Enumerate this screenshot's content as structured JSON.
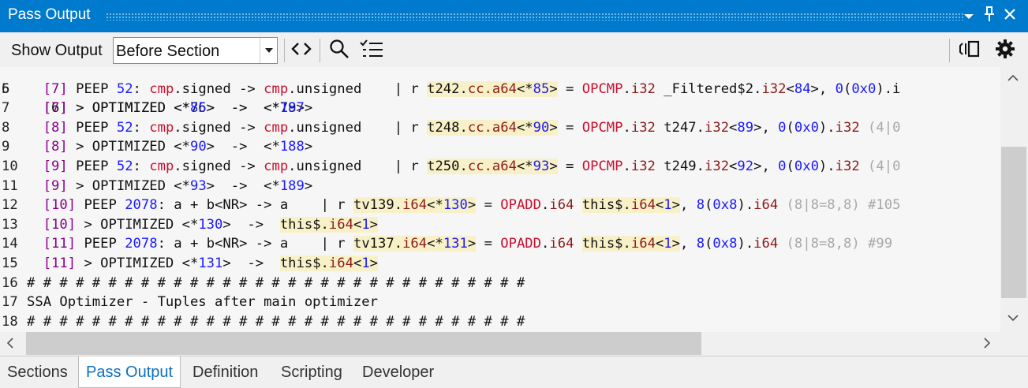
{
  "window": {
    "title": "Pass Output"
  },
  "toolbar": {
    "show_output_label": "Show Output",
    "section_select": {
      "value": "Before Section"
    }
  },
  "icons": {
    "dropdown": "chevron-down-icon",
    "pin": "pin-icon",
    "close": "close-icon",
    "combo": "chevron-down-icon",
    "code": "code-brackets-icon",
    "search": "search-icon",
    "filter": "checklist-icon",
    "sync": "sync-panel-icon",
    "settings": "gear-icon"
  },
  "editor": {
    "partial_top_line": {
      "num": "5",
      "text": "  [6] > OPTIMIZED <*76>  ->  <*79>"
    },
    "lines": [
      {
        "num": "6",
        "tokens": [
          {
            "t": "  "
          },
          {
            "t": "[7]",
            "c": "c-purple"
          },
          {
            "t": " PEEP "
          },
          {
            "t": "52",
            "c": "c-blue"
          },
          {
            "t": ": "
          },
          {
            "t": "cmp",
            "c": "c-red"
          },
          {
            "t": ".signed -> "
          },
          {
            "t": "cmp",
            "c": "c-red"
          },
          {
            "t": ".unsigned    | r "
          },
          {
            "t": "t242.",
            "h": 1
          },
          {
            "t": "cc.a64",
            "c": "c-dark",
            "h": 1
          },
          {
            "t": "<*",
            "h": 1
          },
          {
            "t": "85",
            "c": "c-blue",
            "h": 1
          },
          {
            "t": ">",
            "h": 1
          },
          {
            "t": " = "
          },
          {
            "t": "OPCMP",
            "c": "c-red"
          },
          {
            "t": "."
          },
          {
            "t": "i32",
            "c": "c-dark"
          },
          {
            "t": " _Filtered$2."
          },
          {
            "t": "i32",
            "c": "c-dark"
          },
          {
            "t": "<"
          },
          {
            "t": "84",
            "c": "c-blue"
          },
          {
            "t": ">, "
          },
          {
            "t": "0",
            "c": "c-blue"
          },
          {
            "t": "("
          },
          {
            "t": "0x0",
            "c": "c-blue"
          },
          {
            "t": ").i"
          }
        ]
      },
      {
        "num": "7",
        "tokens": [
          {
            "t": "  "
          },
          {
            "t": "[7]",
            "c": "c-purple"
          },
          {
            "t": " > OPTIMIZED <*"
          },
          {
            "t": "85",
            "c": "c-blue"
          },
          {
            "t": ">  ->  <*"
          },
          {
            "t": "187",
            "c": "c-blue"
          },
          {
            "t": ">"
          }
        ]
      },
      {
        "num": "8",
        "tokens": [
          {
            "t": "  "
          },
          {
            "t": "[8]",
            "c": "c-purple"
          },
          {
            "t": " PEEP "
          },
          {
            "t": "52",
            "c": "c-blue"
          },
          {
            "t": ": "
          },
          {
            "t": "cmp",
            "c": "c-red"
          },
          {
            "t": ".signed -> "
          },
          {
            "t": "cmp",
            "c": "c-red"
          },
          {
            "t": ".unsigned    | r "
          },
          {
            "t": "t248.",
            "h": 1
          },
          {
            "t": "cc.a64",
            "c": "c-dark",
            "h": 1
          },
          {
            "t": "<*",
            "h": 1
          },
          {
            "t": "90",
            "c": "c-blue",
            "h": 1
          },
          {
            "t": ">",
            "h": 1
          },
          {
            "t": " = "
          },
          {
            "t": "OPCMP",
            "c": "c-red"
          },
          {
            "t": "."
          },
          {
            "t": "i32",
            "c": "c-dark"
          },
          {
            "t": " t247."
          },
          {
            "t": "i32",
            "c": "c-dark"
          },
          {
            "t": "<"
          },
          {
            "t": "89",
            "c": "c-blue"
          },
          {
            "t": ">, "
          },
          {
            "t": "0",
            "c": "c-blue"
          },
          {
            "t": "("
          },
          {
            "t": "0x0",
            "c": "c-blue"
          },
          {
            "t": ")."
          },
          {
            "t": "i32",
            "c": "c-dark"
          },
          {
            "t": " (4|0",
            "c": "c-gray"
          }
        ]
      },
      {
        "num": "9",
        "tokens": [
          {
            "t": "  "
          },
          {
            "t": "[8]",
            "c": "c-purple"
          },
          {
            "t": " > OPTIMIZED <*"
          },
          {
            "t": "90",
            "c": "c-blue"
          },
          {
            "t": ">  ->  <*"
          },
          {
            "t": "188",
            "c": "c-blue"
          },
          {
            "t": ">"
          }
        ]
      },
      {
        "num": "10",
        "tokens": [
          {
            "t": "  "
          },
          {
            "t": "[9]",
            "c": "c-purple"
          },
          {
            "t": " PEEP "
          },
          {
            "t": "52",
            "c": "c-blue"
          },
          {
            "t": ": "
          },
          {
            "t": "cmp",
            "c": "c-red"
          },
          {
            "t": ".signed -> "
          },
          {
            "t": "cmp",
            "c": "c-red"
          },
          {
            "t": ".unsigned    | r "
          },
          {
            "t": "t250.",
            "h": 1
          },
          {
            "t": "cc.a64",
            "c": "c-dark",
            "h": 1
          },
          {
            "t": "<*",
            "h": 1
          },
          {
            "t": "93",
            "c": "c-blue",
            "h": 1
          },
          {
            "t": ">",
            "h": 1
          },
          {
            "t": " = "
          },
          {
            "t": "OPCMP",
            "c": "c-red"
          },
          {
            "t": "."
          },
          {
            "t": "i32",
            "c": "c-dark"
          },
          {
            "t": " t249."
          },
          {
            "t": "i32",
            "c": "c-dark"
          },
          {
            "t": "<"
          },
          {
            "t": "92",
            "c": "c-blue"
          },
          {
            "t": ">, "
          },
          {
            "t": "0",
            "c": "c-blue"
          },
          {
            "t": "("
          },
          {
            "t": "0x0",
            "c": "c-blue"
          },
          {
            "t": ")."
          },
          {
            "t": "i32",
            "c": "c-dark"
          },
          {
            "t": " (4|0",
            "c": "c-gray"
          }
        ]
      },
      {
        "num": "11",
        "tokens": [
          {
            "t": "  "
          },
          {
            "t": "[9]",
            "c": "c-purple"
          },
          {
            "t": " > OPTIMIZED <*"
          },
          {
            "t": "93",
            "c": "c-blue"
          },
          {
            "t": ">  ->  <*"
          },
          {
            "t": "189",
            "c": "c-blue"
          },
          {
            "t": ">"
          }
        ]
      },
      {
        "num": "12",
        "tokens": [
          {
            "t": "  "
          },
          {
            "t": "[10]",
            "c": "c-purple"
          },
          {
            "t": " PEEP "
          },
          {
            "t": "2078",
            "c": "c-blue"
          },
          {
            "t": ": a + b<NR> -> a    | r "
          },
          {
            "t": "tv139.",
            "h": 1
          },
          {
            "t": "i64",
            "c": "c-dark",
            "h": 1
          },
          {
            "t": "<*",
            "h": 1
          },
          {
            "t": "130",
            "c": "c-blue",
            "h": 1
          },
          {
            "t": ">",
            "h": 1
          },
          {
            "t": " = "
          },
          {
            "t": "OPADD",
            "c": "c-red"
          },
          {
            "t": "."
          },
          {
            "t": "i64",
            "c": "c-dark"
          },
          {
            "t": " "
          },
          {
            "t": "this$.",
            "h": 1
          },
          {
            "t": "i64",
            "c": "c-dark",
            "h": 1
          },
          {
            "t": "<",
            "h": 1
          },
          {
            "t": "1",
            "c": "c-blue",
            "h": 1
          },
          {
            "t": ">",
            "h": 1
          },
          {
            "t": ", "
          },
          {
            "t": "8",
            "c": "c-blue"
          },
          {
            "t": "("
          },
          {
            "t": "0x8",
            "c": "c-blue"
          },
          {
            "t": ")."
          },
          {
            "t": "i64",
            "c": "c-dark"
          },
          {
            "t": " (8|8=8,8) #105",
            "c": "c-gray"
          }
        ]
      },
      {
        "num": "13",
        "tokens": [
          {
            "t": "  "
          },
          {
            "t": "[10]",
            "c": "c-purple"
          },
          {
            "t": " > OPTIMIZED <*"
          },
          {
            "t": "130",
            "c": "c-blue"
          },
          {
            "t": ">  ->  "
          },
          {
            "t": "this$.",
            "h": 1
          },
          {
            "t": "i64",
            "c": "c-dark",
            "h": 1
          },
          {
            "t": "<",
            "h": 1
          },
          {
            "t": "1",
            "c": "c-blue",
            "h": 1
          },
          {
            "t": ">",
            "h": 1
          }
        ]
      },
      {
        "num": "14",
        "tokens": [
          {
            "t": "  "
          },
          {
            "t": "[11]",
            "c": "c-purple"
          },
          {
            "t": " PEEP "
          },
          {
            "t": "2078",
            "c": "c-blue"
          },
          {
            "t": ": a + b<NR> -> a    | r "
          },
          {
            "t": "tv137.",
            "h": 1
          },
          {
            "t": "i64",
            "c": "c-dark",
            "h": 1
          },
          {
            "t": "<*",
            "h": 1
          },
          {
            "t": "131",
            "c": "c-blue",
            "h": 1
          },
          {
            "t": ">",
            "h": 1
          },
          {
            "t": " = "
          },
          {
            "t": "OPADD",
            "c": "c-red"
          },
          {
            "t": "."
          },
          {
            "t": "i64",
            "c": "c-dark"
          },
          {
            "t": " "
          },
          {
            "t": "this$.",
            "h": 1
          },
          {
            "t": "i64",
            "c": "c-dark",
            "h": 1
          },
          {
            "t": "<",
            "h": 1
          },
          {
            "t": "1",
            "c": "c-blue",
            "h": 1
          },
          {
            "t": ">",
            "h": 1
          },
          {
            "t": ", "
          },
          {
            "t": "8",
            "c": "c-blue"
          },
          {
            "t": "("
          },
          {
            "t": "0x8",
            "c": "c-blue"
          },
          {
            "t": ")."
          },
          {
            "t": "i64",
            "c": "c-dark"
          },
          {
            "t": " (8|8=8,8) #99",
            "c": "c-gray"
          }
        ]
      },
      {
        "num": "15",
        "tokens": [
          {
            "t": "  "
          },
          {
            "t": "[11]",
            "c": "c-purple"
          },
          {
            "t": " > OPTIMIZED <*"
          },
          {
            "t": "131",
            "c": "c-blue"
          },
          {
            "t": ">  ->  "
          },
          {
            "t": "this$.",
            "h": 1
          },
          {
            "t": "i64",
            "c": "c-dark",
            "h": 1
          },
          {
            "t": "<",
            "h": 1
          },
          {
            "t": "1",
            "c": "c-blue",
            "h": 1
          },
          {
            "t": ">",
            "h": 1
          }
        ]
      },
      {
        "num": "16",
        "tokens": [
          {
            "t": "# # # # # # # # # # # # # # # # # # # # # # # # # # # # # # #"
          }
        ]
      },
      {
        "num": "17",
        "tokens": [
          {
            "t": "SSA Optimizer - Tuples after main optimizer"
          }
        ]
      },
      {
        "num": "18",
        "tokens": [
          {
            "t": "# # # # # # # # # # # # # # # # # # # # # # # # # # # # # # #"
          }
        ]
      }
    ]
  },
  "tabs": [
    {
      "label": "Sections",
      "active": false
    },
    {
      "label": "Pass Output",
      "active": true
    },
    {
      "label": "Definition",
      "active": false
    },
    {
      "label": "Scripting",
      "active": false
    },
    {
      "label": "Developer",
      "active": false
    }
  ]
}
